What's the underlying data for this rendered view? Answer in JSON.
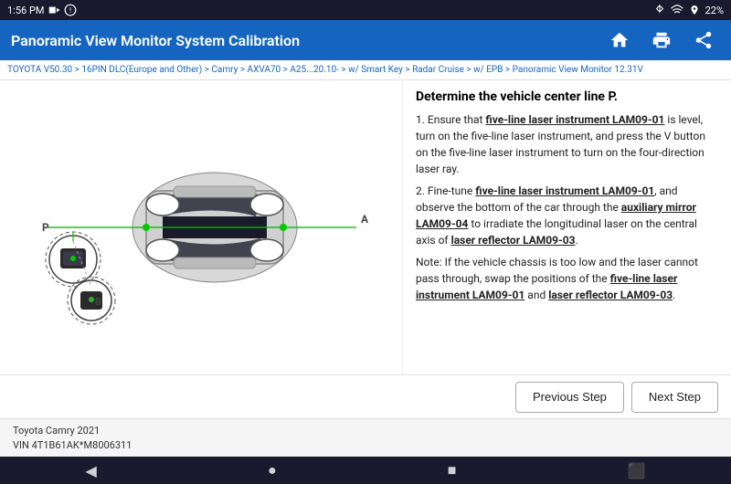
{
  "statusBar": {
    "time": "1:56 PM",
    "battery": "22%"
  },
  "titleBar": {
    "title": "Panoramic View Monitor System Calibration"
  },
  "breadcrumb": {
    "text": "TOYOTA V50.30 > 16PIN DLC(Europe and Other) > Camry > AXVA70 > A25...20.10- > w/ Smart Key > Radar Cruise > w/ EPB > Panoramic View Monitor  12.31V"
  },
  "instructions": {
    "heading": "Determine the vehicle center line P.",
    "paragraph1": "1. Ensure that five-line laser instrument LAM09-01 is level, turn on the five-line laser instrument, and press the V button on the five-line laser instrument to turn on the four-direction laser ray.",
    "paragraph2": "2. Fine-tune five-line laser instrument LAM09-01, and observe the bottom of the car through the auxiliary mirror LAM09-04 to irradiate the longitudinal laser on the central axis of laser reflector LAM09-03.",
    "paragraph3": "Note: If the vehicle chassis is too low and the laser cannot pass through, swap the positions of the five-line laser instrument LAM09-01 and laser reflector LAM09-03."
  },
  "buttons": {
    "previousStep": "Previous Step",
    "nextStep": "Next Step"
  },
  "bottomBar": {
    "make": "Toyota Camry 2021",
    "vin": "VIN 4T1B61AK*M8006311"
  },
  "navBar": {
    "back": "◀",
    "home": "●",
    "recents": "■",
    "cast": "⬛"
  }
}
